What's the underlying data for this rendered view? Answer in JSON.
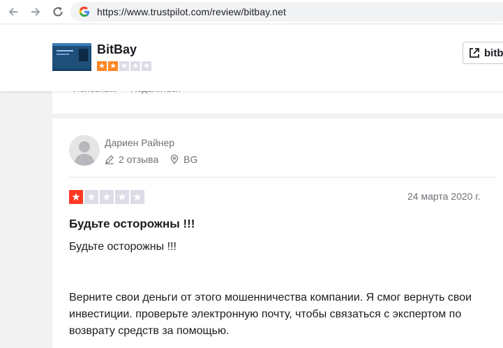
{
  "browser": {
    "url": "https://www.trustpilot.com/review/bitbay.net"
  },
  "company": {
    "name": "BitBay",
    "rating_stars": 2,
    "max_stars": 5,
    "visit_label": "bitb",
    "star_color": "#ff8622"
  },
  "previous_review": {
    "helpful_label": "Полезным",
    "share_label": "Поделиться"
  },
  "review": {
    "author": "Дариен Райнер",
    "reviews_count": "2 отзыва",
    "country": "BG",
    "rating_stars": 1,
    "star_color": "#ff3722",
    "date": "24 марта 2020 г.",
    "title": "Будьте осторожны !!!",
    "body_line1": "Будьте осторожны !!!",
    "body_paragraph": "Верните свои деньги от этого мошенничества компании. Я смог вернуть свои инвестиции. проверьте электронную почту, чтобы связаться с экспертом по возврату средств за помощью."
  }
}
